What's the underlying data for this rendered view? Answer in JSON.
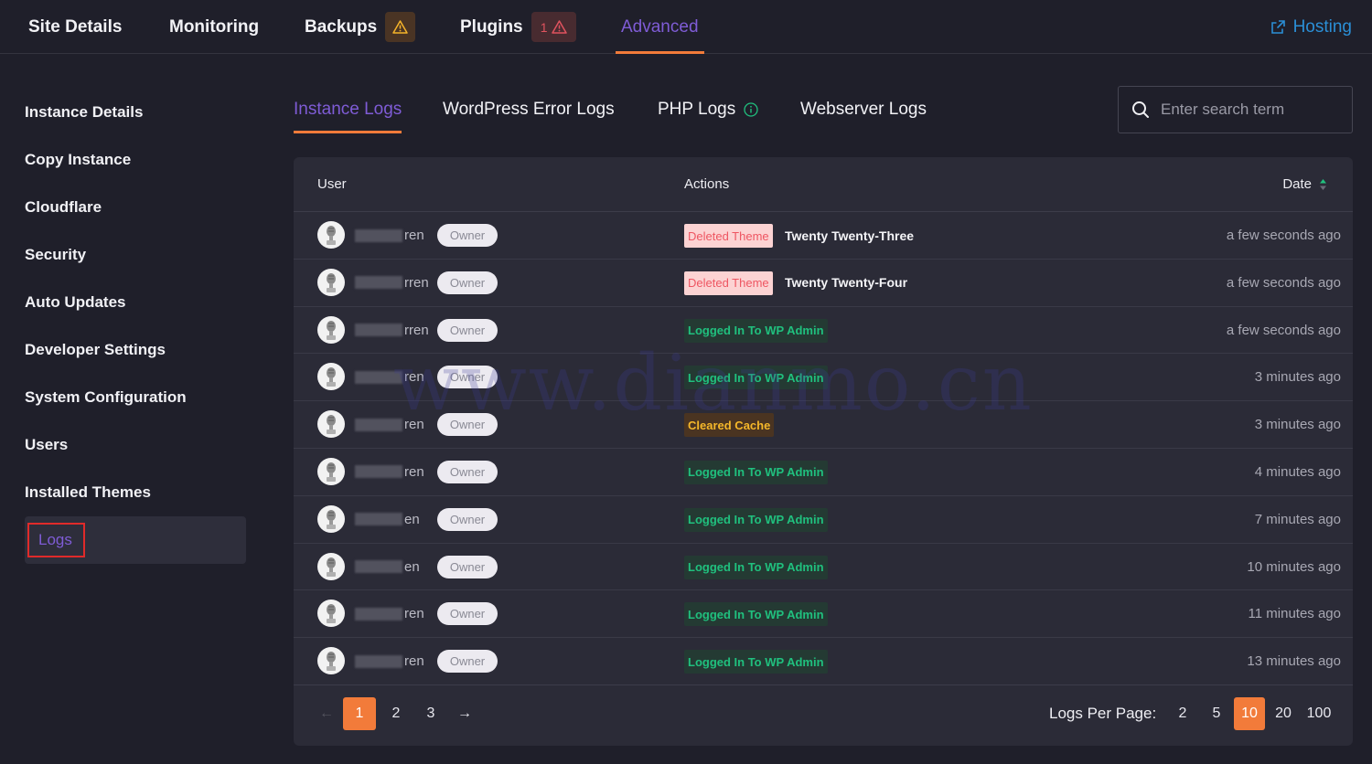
{
  "topnav": {
    "tabs": [
      {
        "label": "Site Details"
      },
      {
        "label": "Monitoring"
      },
      {
        "label": "Backups"
      },
      {
        "label": "Plugins",
        "badge_count": "1"
      },
      {
        "label": "Advanced"
      }
    ],
    "hosting_label": "Hosting"
  },
  "sidebar": {
    "items": [
      {
        "label": "Instance Details"
      },
      {
        "label": "Copy Instance"
      },
      {
        "label": "Cloudflare"
      },
      {
        "label": "Security"
      },
      {
        "label": "Auto Updates"
      },
      {
        "label": "Developer Settings"
      },
      {
        "label": "System Configuration"
      },
      {
        "label": "Users"
      },
      {
        "label": "Installed Themes"
      },
      {
        "label": "Logs"
      }
    ]
  },
  "subtabs": [
    {
      "label": "Instance Logs"
    },
    {
      "label": "WordPress Error Logs"
    },
    {
      "label": "PHP Logs"
    },
    {
      "label": "Webserver Logs"
    }
  ],
  "search": {
    "placeholder": "Enter search term"
  },
  "table": {
    "headers": {
      "user": "User",
      "actions": "Actions",
      "date": "Date"
    },
    "rows": [
      {
        "user_suffix": "ren",
        "role": "Owner",
        "action": "Deleted Theme",
        "action_type": "deleted",
        "target": "Twenty Twenty-Three",
        "date": "a few seconds ago"
      },
      {
        "user_suffix": "rren",
        "role": "Owner",
        "action": "Deleted Theme",
        "action_type": "deleted",
        "target": "Twenty Twenty-Four",
        "date": "a few seconds ago"
      },
      {
        "user_suffix": "rren",
        "role": "Owner",
        "action": "Logged In To WP Admin",
        "action_type": "login",
        "target": "",
        "date": "a few seconds ago"
      },
      {
        "user_suffix": "ren",
        "role": "Owner",
        "action": "Logged In To WP Admin",
        "action_type": "login",
        "target": "",
        "date": "3 minutes ago"
      },
      {
        "user_suffix": "ren",
        "role": "Owner",
        "action": "Cleared Cache",
        "action_type": "cache",
        "target": "",
        "date": "3 minutes ago"
      },
      {
        "user_suffix": "ren",
        "role": "Owner",
        "action": "Logged In To WP Admin",
        "action_type": "login",
        "target": "",
        "date": "4 minutes ago"
      },
      {
        "user_suffix": "en",
        "role": "Owner",
        "action": "Logged In To WP Admin",
        "action_type": "login",
        "target": "",
        "date": "7 minutes ago"
      },
      {
        "user_suffix": "en",
        "role": "Owner",
        "action": "Logged In To WP Admin",
        "action_type": "login",
        "target": "",
        "date": "10 minutes ago"
      },
      {
        "user_suffix": "ren",
        "role": "Owner",
        "action": "Logged In To WP Admin",
        "action_type": "login",
        "target": "",
        "date": "11 minutes ago"
      },
      {
        "user_suffix": "ren",
        "role": "Owner",
        "action": "Logged In To WP Admin",
        "action_type": "login",
        "target": "",
        "date": "13 minutes ago"
      }
    ]
  },
  "pagination": {
    "prev_arrow": "←",
    "next_arrow": "→",
    "pages": [
      "1",
      "2",
      "3"
    ],
    "current_page": "1",
    "per_page_label": "Logs Per Page:",
    "per_page_options": [
      "2",
      "5",
      "10",
      "20",
      "100"
    ],
    "current_per_page": "10"
  },
  "watermark": "www.dianmo.cn",
  "colors": {
    "accent_purple": "#7f5cd6",
    "accent_orange": "#f27b3a",
    "link_blue": "#2b8fd6"
  }
}
